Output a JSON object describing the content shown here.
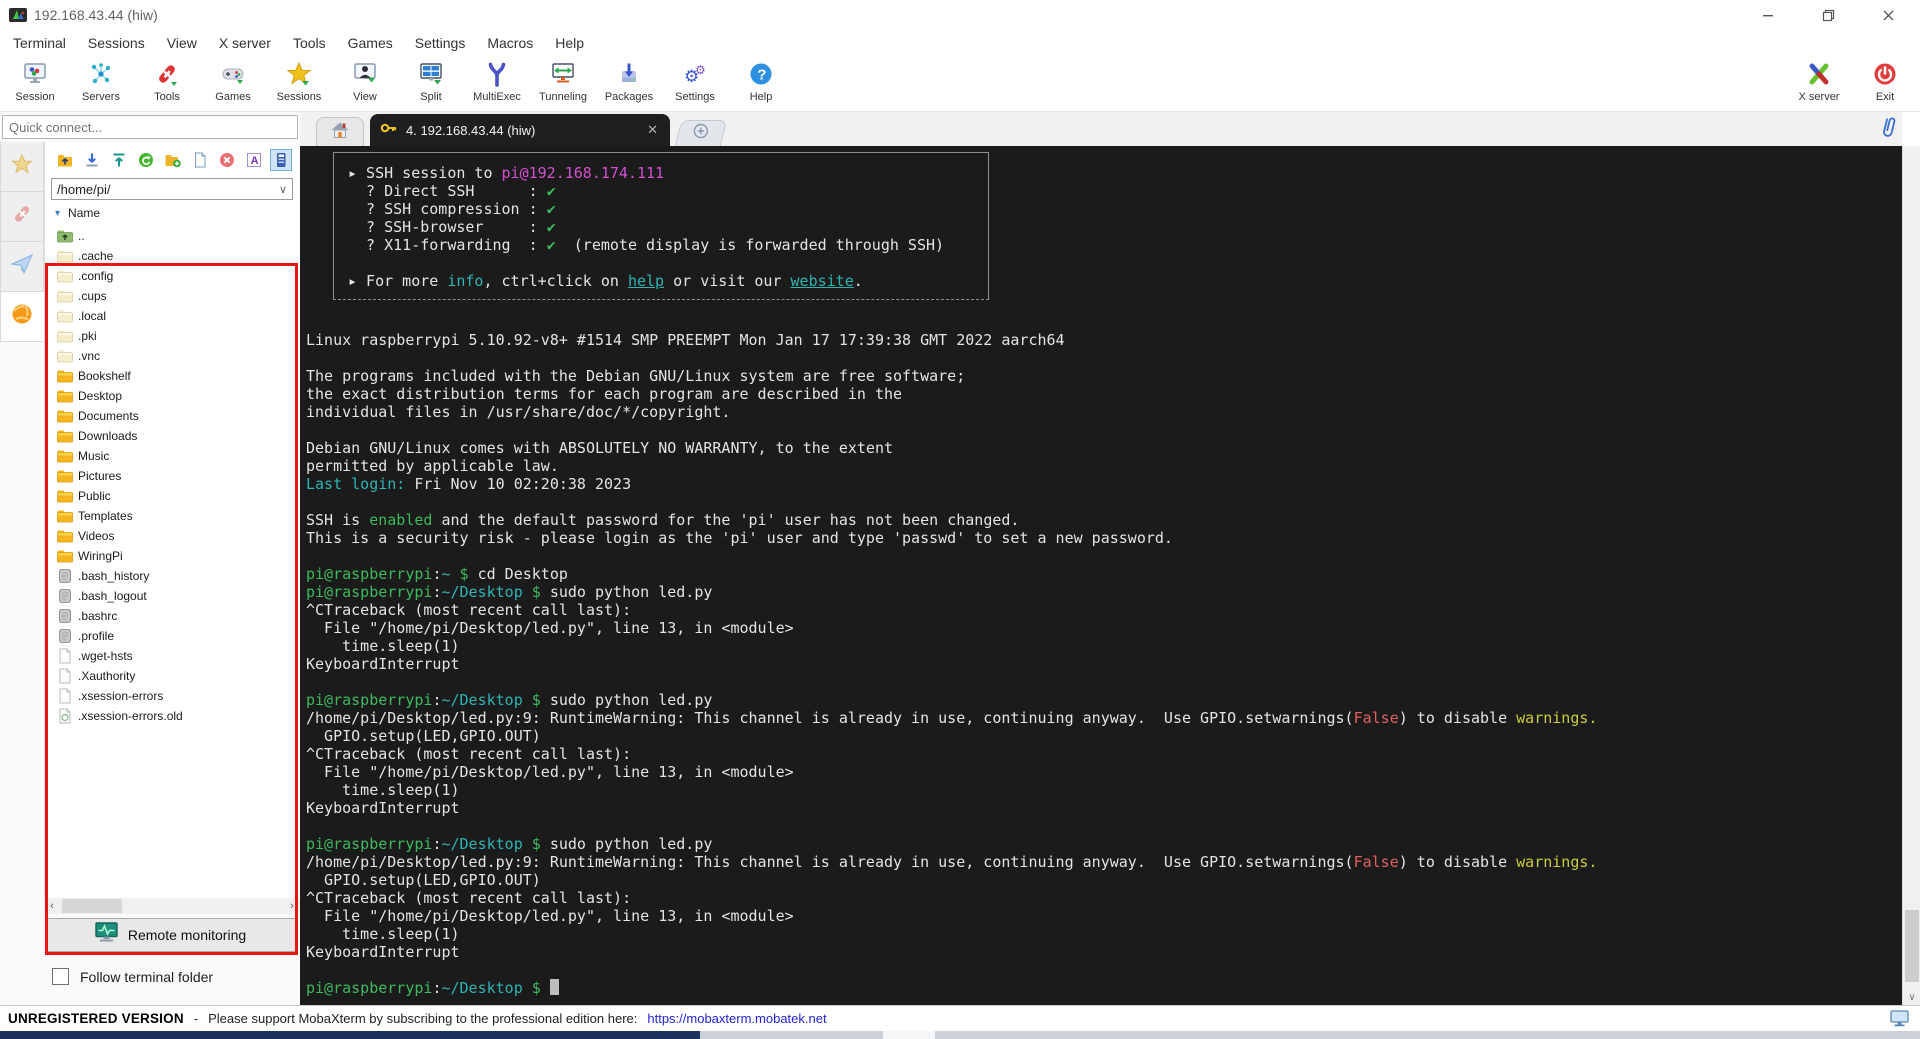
{
  "window": {
    "title": "192.168.43.44 (hiw)",
    "icon": "mobaxterm-logo",
    "controls": [
      {
        "name": "minimize",
        "icon": "minimize-icon"
      },
      {
        "name": "maximize",
        "icon": "maximize-icon"
      },
      {
        "name": "close",
        "icon": "close-icon"
      }
    ]
  },
  "menubar": {
    "items": [
      "Terminal",
      "Sessions",
      "View",
      "X server",
      "Tools",
      "Games",
      "Settings",
      "Macros",
      "Help"
    ]
  },
  "toolbar": {
    "left_items": [
      {
        "label": "Session",
        "icon": "session"
      },
      {
        "label": "Servers",
        "icon": "servers"
      },
      {
        "label": "Tools",
        "icon": "tools"
      },
      {
        "label": "Games",
        "icon": "games"
      },
      {
        "label": "Sessions",
        "icon": "sessions"
      },
      {
        "label": "View",
        "icon": "view"
      },
      {
        "label": "Split",
        "icon": "split"
      },
      {
        "label": "MultiExec",
        "icon": "multiexec"
      },
      {
        "label": "Tunneling",
        "icon": "tunneling"
      },
      {
        "label": "Packages",
        "icon": "packages"
      },
      {
        "label": "Settings",
        "icon": "settings"
      },
      {
        "label": "Help",
        "icon": "help"
      }
    ],
    "right_items": [
      {
        "label": "X server",
        "icon": "xserver"
      },
      {
        "label": "Exit",
        "icon": "exit"
      }
    ]
  },
  "sidebar": {
    "quick_connect_placeholder": "Quick connect...",
    "strip_icons": [
      "star",
      "knife",
      "plane",
      "globe"
    ],
    "sftp_toolbar": [
      "parent-folder",
      "download",
      "upload",
      "refresh",
      "new-folder",
      "new-file",
      "delete",
      "rename",
      "sync-browser"
    ],
    "path_value": "/home/pi/",
    "column_header": "Name",
    "sort_arrow": "▾",
    "files": [
      {
        "name": "..",
        "icon": "folder-up"
      },
      {
        "name": ".cache",
        "icon": "folder-pale"
      },
      {
        "name": ".config",
        "icon": "folder-pale"
      },
      {
        "name": ".cups",
        "icon": "folder-pale"
      },
      {
        "name": ".local",
        "icon": "folder-pale"
      },
      {
        "name": ".pki",
        "icon": "folder-pale"
      },
      {
        "name": ".vnc",
        "icon": "folder-pale"
      },
      {
        "name": "Bookshelf",
        "icon": "folder"
      },
      {
        "name": "Desktop",
        "icon": "folder"
      },
      {
        "name": "Documents",
        "icon": "folder"
      },
      {
        "name": "Downloads",
        "icon": "folder"
      },
      {
        "name": "Music",
        "icon": "folder"
      },
      {
        "name": "Pictures",
        "icon": "folder"
      },
      {
        "name": "Public",
        "icon": "folder"
      },
      {
        "name": "Templates",
        "icon": "folder"
      },
      {
        "name": "Videos",
        "icon": "folder"
      },
      {
        "name": "WiringPi",
        "icon": "folder"
      },
      {
        "name": ".bash_history",
        "icon": "file-gray"
      },
      {
        "name": ".bash_logout",
        "icon": "file-gray"
      },
      {
        "name": ".bashrc",
        "icon": "file-gray"
      },
      {
        "name": ".profile",
        "icon": "file-gray"
      },
      {
        "name": ".wget-hsts",
        "icon": "file-plain"
      },
      {
        "name": ".Xauthority",
        "icon": "file-plain"
      },
      {
        "name": ".xsession-errors",
        "icon": "file-plain"
      },
      {
        "name": ".xsession-errors.old",
        "icon": "file-old"
      }
    ],
    "remote_monitoring_label": "Remote monitoring",
    "follow_terminal_label": "Follow terminal folder"
  },
  "tabs": {
    "active_label": "4. 192.168.43.44 (hiw)",
    "close_glyph": "✕"
  },
  "terminal": {
    "banner_lines": [
      [
        [
          "w",
          "▸ SSH session to "
        ],
        [
          "m",
          "pi@192.168.174.111"
        ]
      ],
      [
        [
          "w",
          "  ? Direct SSH      : "
        ],
        [
          "g",
          "✔"
        ]
      ],
      [
        [
          "w",
          "  ? SSH compression : "
        ],
        [
          "g",
          "✔"
        ]
      ],
      [
        [
          "w",
          "  ? SSH-browser     : "
        ],
        [
          "g",
          "✔"
        ]
      ],
      [
        [
          "w",
          "  ? X11-forwarding  : "
        ],
        [
          "g",
          "✔"
        ],
        [
          "w",
          "  (remote display is forwarded through SSH)"
        ]
      ],
      [],
      [
        [
          "w",
          "▸ For more "
        ],
        [
          "c",
          "info"
        ],
        [
          "w",
          ", ctrl+click on "
        ],
        [
          "u",
          "help"
        ],
        [
          "w",
          " or visit our "
        ],
        [
          "u",
          "website"
        ],
        [
          "w",
          "."
        ]
      ]
    ],
    "lines": [
      [
        [
          "w",
          "Linux raspberrypi 5.10.92-v8+ #1514 SMP PREEMPT Mon Jan 17 17:39:38 GMT 2022 aarch64"
        ]
      ],
      [],
      [
        [
          "w",
          "The programs included with the Debian GNU/Linux system are free software;"
        ]
      ],
      [
        [
          "w",
          "the exact distribution terms for each program are described in the"
        ]
      ],
      [
        [
          "w",
          "individual files in /usr/share/doc/*/copyright."
        ]
      ],
      [],
      [
        [
          "w",
          "Debian GNU/Linux comes with ABSOLUTELY NO WARRANTY, to the extent"
        ]
      ],
      [
        [
          "w",
          "permitted by applicable law."
        ]
      ],
      [
        [
          "c",
          "Last login:"
        ],
        [
          "w",
          " Fri Nov 10 02:20:38 2023"
        ]
      ],
      [],
      [
        [
          "w",
          "SSH is "
        ],
        [
          "g",
          "enabled"
        ],
        [
          "w",
          " and the default password for the 'pi' user has not been changed."
        ]
      ],
      [
        [
          "w",
          "This is a security risk - please login as the 'pi' user and type 'passwd' to set a new password."
        ]
      ],
      [],
      [
        [
          "g",
          "pi@raspberrypi"
        ],
        [
          "w",
          ":"
        ],
        [
          "c",
          "~"
        ],
        [
          "w",
          " "
        ],
        [
          "g",
          "$"
        ],
        [
          "w",
          " cd Desktop"
        ]
      ],
      [
        [
          "g",
          "pi@raspberrypi"
        ],
        [
          "w",
          ":"
        ],
        [
          "c",
          "~/Desktop"
        ],
        [
          "w",
          " "
        ],
        [
          "g",
          "$"
        ],
        [
          "w",
          " sudo python led.py"
        ]
      ],
      [
        [
          "w",
          "^CTraceback (most recent call last):"
        ]
      ],
      [
        [
          "w",
          "  File \"/home/pi/Desktop/led.py\", line 13, in <module>"
        ]
      ],
      [
        [
          "w",
          "    time.sleep(1)"
        ]
      ],
      [
        [
          "w",
          "KeyboardInterrupt"
        ]
      ],
      [],
      [
        [
          "g",
          "pi@raspberrypi"
        ],
        [
          "w",
          ":"
        ],
        [
          "c",
          "~/Desktop"
        ],
        [
          "w",
          " "
        ],
        [
          "g",
          "$"
        ],
        [
          "w",
          " sudo python led.py"
        ]
      ],
      [
        [
          "w",
          "/home/pi/Desktop/led.py:9: RuntimeWarning: This channel is already in use, continuing anyway.  Use GPIO.setwarnings("
        ],
        [
          "r",
          "False"
        ],
        [
          "w",
          ") to disable "
        ],
        [
          "y",
          "warnings."
        ]
      ],
      [
        [
          "w",
          "  GPIO.setup(LED,GPIO.OUT)"
        ]
      ],
      [
        [
          "w",
          "^CTraceback (most recent call last):"
        ]
      ],
      [
        [
          "w",
          "  File \"/home/pi/Desktop/led.py\", line 13, in <module>"
        ]
      ],
      [
        [
          "w",
          "    time.sleep(1)"
        ]
      ],
      [
        [
          "w",
          "KeyboardInterrupt"
        ]
      ],
      [],
      [
        [
          "g",
          "pi@raspberrypi"
        ],
        [
          "w",
          ":"
        ],
        [
          "c",
          "~/Desktop"
        ],
        [
          "w",
          " "
        ],
        [
          "g",
          "$"
        ],
        [
          "w",
          " sudo python led.py"
        ]
      ],
      [
        [
          "w",
          "/home/pi/Desktop/led.py:9: RuntimeWarning: This channel is already in use, continuing anyway.  Use GPIO.setwarnings("
        ],
        [
          "r",
          "False"
        ],
        [
          "w",
          ") to disable "
        ],
        [
          "y",
          "warnings."
        ]
      ],
      [
        [
          "w",
          "  GPIO.setup(LED,GPIO.OUT)"
        ]
      ],
      [
        [
          "w",
          "^CTraceback (most recent call last):"
        ]
      ],
      [
        [
          "w",
          "  File \"/home/pi/Desktop/led.py\", line 13, in <module>"
        ]
      ],
      [
        [
          "w",
          "    time.sleep(1)"
        ]
      ],
      [
        [
          "w",
          "KeyboardInterrupt"
        ]
      ],
      [],
      [
        [
          "g",
          "pi@raspberrypi"
        ],
        [
          "w",
          ":"
        ],
        [
          "c",
          "~/Desktop"
        ],
        [
          "w",
          " "
        ],
        [
          "g",
          "$"
        ],
        [
          "w",
          " "
        ],
        [
          "cur",
          ""
        ]
      ]
    ]
  },
  "statusbar": {
    "registered": "UNREGISTERED VERSION",
    "dash": "-",
    "message": "Please support MobaXterm by subscribing to the professional edition here:",
    "link": "https://mobaxterm.mobatek.net"
  }
}
